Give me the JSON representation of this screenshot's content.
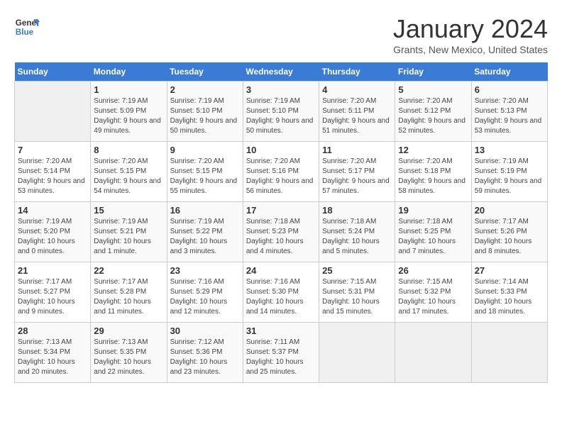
{
  "header": {
    "logo_line1": "General",
    "logo_line2": "Blue",
    "title": "January 2024",
    "subtitle": "Grants, New Mexico, United States"
  },
  "weekdays": [
    "Sunday",
    "Monday",
    "Tuesday",
    "Wednesday",
    "Thursday",
    "Friday",
    "Saturday"
  ],
  "weeks": [
    [
      {
        "day": "",
        "sunrise": "",
        "sunset": "",
        "daylight": ""
      },
      {
        "day": "1",
        "sunrise": "Sunrise: 7:19 AM",
        "sunset": "Sunset: 5:09 PM",
        "daylight": "Daylight: 9 hours and 49 minutes."
      },
      {
        "day": "2",
        "sunrise": "Sunrise: 7:19 AM",
        "sunset": "Sunset: 5:10 PM",
        "daylight": "Daylight: 9 hours and 50 minutes."
      },
      {
        "day": "3",
        "sunrise": "Sunrise: 7:19 AM",
        "sunset": "Sunset: 5:10 PM",
        "daylight": "Daylight: 9 hours and 50 minutes."
      },
      {
        "day": "4",
        "sunrise": "Sunrise: 7:20 AM",
        "sunset": "Sunset: 5:11 PM",
        "daylight": "Daylight: 9 hours and 51 minutes."
      },
      {
        "day": "5",
        "sunrise": "Sunrise: 7:20 AM",
        "sunset": "Sunset: 5:12 PM",
        "daylight": "Daylight: 9 hours and 52 minutes."
      },
      {
        "day": "6",
        "sunrise": "Sunrise: 7:20 AM",
        "sunset": "Sunset: 5:13 PM",
        "daylight": "Daylight: 9 hours and 53 minutes."
      }
    ],
    [
      {
        "day": "7",
        "sunrise": "Sunrise: 7:20 AM",
        "sunset": "Sunset: 5:14 PM",
        "daylight": "Daylight: 9 hours and 53 minutes."
      },
      {
        "day": "8",
        "sunrise": "Sunrise: 7:20 AM",
        "sunset": "Sunset: 5:15 PM",
        "daylight": "Daylight: 9 hours and 54 minutes."
      },
      {
        "day": "9",
        "sunrise": "Sunrise: 7:20 AM",
        "sunset": "Sunset: 5:15 PM",
        "daylight": "Daylight: 9 hours and 55 minutes."
      },
      {
        "day": "10",
        "sunrise": "Sunrise: 7:20 AM",
        "sunset": "Sunset: 5:16 PM",
        "daylight": "Daylight: 9 hours and 56 minutes."
      },
      {
        "day": "11",
        "sunrise": "Sunrise: 7:20 AM",
        "sunset": "Sunset: 5:17 PM",
        "daylight": "Daylight: 9 hours and 57 minutes."
      },
      {
        "day": "12",
        "sunrise": "Sunrise: 7:20 AM",
        "sunset": "Sunset: 5:18 PM",
        "daylight": "Daylight: 9 hours and 58 minutes."
      },
      {
        "day": "13",
        "sunrise": "Sunrise: 7:19 AM",
        "sunset": "Sunset: 5:19 PM",
        "daylight": "Daylight: 9 hours and 59 minutes."
      }
    ],
    [
      {
        "day": "14",
        "sunrise": "Sunrise: 7:19 AM",
        "sunset": "Sunset: 5:20 PM",
        "daylight": "Daylight: 10 hours and 0 minutes."
      },
      {
        "day": "15",
        "sunrise": "Sunrise: 7:19 AM",
        "sunset": "Sunset: 5:21 PM",
        "daylight": "Daylight: 10 hours and 1 minute."
      },
      {
        "day": "16",
        "sunrise": "Sunrise: 7:19 AM",
        "sunset": "Sunset: 5:22 PM",
        "daylight": "Daylight: 10 hours and 3 minutes."
      },
      {
        "day": "17",
        "sunrise": "Sunrise: 7:18 AM",
        "sunset": "Sunset: 5:23 PM",
        "daylight": "Daylight: 10 hours and 4 minutes."
      },
      {
        "day": "18",
        "sunrise": "Sunrise: 7:18 AM",
        "sunset": "Sunset: 5:24 PM",
        "daylight": "Daylight: 10 hours and 5 minutes."
      },
      {
        "day": "19",
        "sunrise": "Sunrise: 7:18 AM",
        "sunset": "Sunset: 5:25 PM",
        "daylight": "Daylight: 10 hours and 7 minutes."
      },
      {
        "day": "20",
        "sunrise": "Sunrise: 7:17 AM",
        "sunset": "Sunset: 5:26 PM",
        "daylight": "Daylight: 10 hours and 8 minutes."
      }
    ],
    [
      {
        "day": "21",
        "sunrise": "Sunrise: 7:17 AM",
        "sunset": "Sunset: 5:27 PM",
        "daylight": "Daylight: 10 hours and 9 minutes."
      },
      {
        "day": "22",
        "sunrise": "Sunrise: 7:17 AM",
        "sunset": "Sunset: 5:28 PM",
        "daylight": "Daylight: 10 hours and 11 minutes."
      },
      {
        "day": "23",
        "sunrise": "Sunrise: 7:16 AM",
        "sunset": "Sunset: 5:29 PM",
        "daylight": "Daylight: 10 hours and 12 minutes."
      },
      {
        "day": "24",
        "sunrise": "Sunrise: 7:16 AM",
        "sunset": "Sunset: 5:30 PM",
        "daylight": "Daylight: 10 hours and 14 minutes."
      },
      {
        "day": "25",
        "sunrise": "Sunrise: 7:15 AM",
        "sunset": "Sunset: 5:31 PM",
        "daylight": "Daylight: 10 hours and 15 minutes."
      },
      {
        "day": "26",
        "sunrise": "Sunrise: 7:15 AM",
        "sunset": "Sunset: 5:32 PM",
        "daylight": "Daylight: 10 hours and 17 minutes."
      },
      {
        "day": "27",
        "sunrise": "Sunrise: 7:14 AM",
        "sunset": "Sunset: 5:33 PM",
        "daylight": "Daylight: 10 hours and 18 minutes."
      }
    ],
    [
      {
        "day": "28",
        "sunrise": "Sunrise: 7:13 AM",
        "sunset": "Sunset: 5:34 PM",
        "daylight": "Daylight: 10 hours and 20 minutes."
      },
      {
        "day": "29",
        "sunrise": "Sunrise: 7:13 AM",
        "sunset": "Sunset: 5:35 PM",
        "daylight": "Daylight: 10 hours and 22 minutes."
      },
      {
        "day": "30",
        "sunrise": "Sunrise: 7:12 AM",
        "sunset": "Sunset: 5:36 PM",
        "daylight": "Daylight: 10 hours and 23 minutes."
      },
      {
        "day": "31",
        "sunrise": "Sunrise: 7:11 AM",
        "sunset": "Sunset: 5:37 PM",
        "daylight": "Daylight: 10 hours and 25 minutes."
      },
      {
        "day": "",
        "sunrise": "",
        "sunset": "",
        "daylight": ""
      },
      {
        "day": "",
        "sunrise": "",
        "sunset": "",
        "daylight": ""
      },
      {
        "day": "",
        "sunrise": "",
        "sunset": "",
        "daylight": ""
      }
    ]
  ]
}
